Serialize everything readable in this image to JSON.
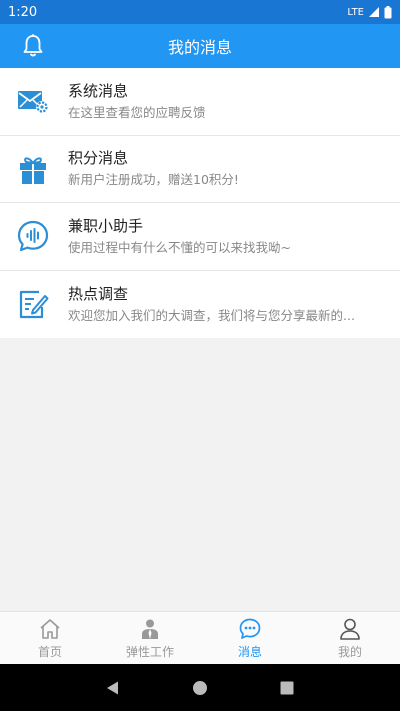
{
  "status_bar": {
    "time": "1:20",
    "network": "LTE"
  },
  "header": {
    "title": "我的消息"
  },
  "messages": [
    {
      "title": "系统消息",
      "subtitle": "在这里查看您的应聘反馈",
      "icon": "mail-settings-icon"
    },
    {
      "title": "积分消息",
      "subtitle": "新用户注册成功，赠送10积分!",
      "icon": "gift-icon"
    },
    {
      "title": "兼职小助手",
      "subtitle": "使用过程中有什么不懂的可以来找我呦~",
      "icon": "voice-chat-icon"
    },
    {
      "title": "热点调查",
      "subtitle": "欢迎您加入我们的大调查，我们将与您分享最新的...",
      "icon": "survey-icon"
    }
  ],
  "tabs": [
    {
      "label": "首页",
      "icon": "home-icon",
      "active": false
    },
    {
      "label": "弹性工作",
      "icon": "worker-icon",
      "active": false
    },
    {
      "label": "消息",
      "icon": "message-icon",
      "active": true
    },
    {
      "label": "我的",
      "icon": "user-icon",
      "active": false
    }
  ],
  "colors": {
    "primary": "#2196f3",
    "status_bar": "#1976d2",
    "icon_blue": "#2b8fd6"
  }
}
